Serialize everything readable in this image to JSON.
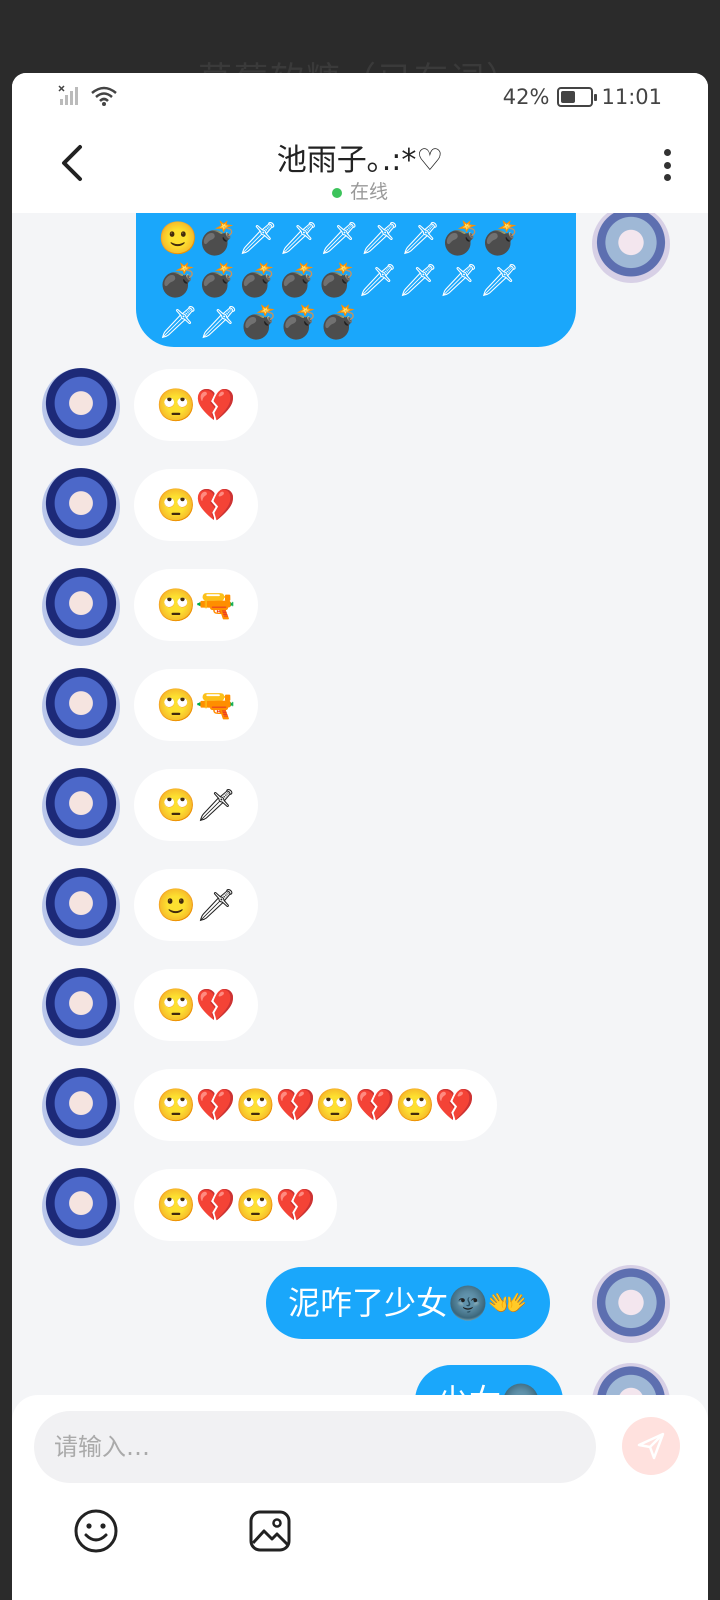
{
  "background_title": "草莓软糖（已有词）",
  "status": {
    "battery": "42%",
    "time": "11:01"
  },
  "header": {
    "title": "池雨子｡.:*♡",
    "status": "在线"
  },
  "messages": [
    {
      "from": "me",
      "text": "🙂💣🗡🗡🗡🗡🗡💣💣💣💣💣💣💣🗡🗡🗡🗡🗡🗡💣💣💣"
    },
    {
      "from": "her",
      "text": "🙄💔"
    },
    {
      "from": "her",
      "text": "🙄💔"
    },
    {
      "from": "her",
      "text": "🙄🔫"
    },
    {
      "from": "her",
      "text": "🙄🔫"
    },
    {
      "from": "her",
      "text": "🙄🗡"
    },
    {
      "from": "her",
      "text": "🙂🗡"
    },
    {
      "from": "her",
      "text": "🙄💔"
    },
    {
      "from": "her",
      "text": "🙄💔🙄💔🙄💔🙄💔"
    },
    {
      "from": "her",
      "text": "🙄💔🙄💔"
    },
    {
      "from": "me",
      "text": "泥咋了少女🌚👐"
    },
    {
      "from": "me",
      "text": "少女🌚"
    }
  ],
  "composer": {
    "placeholder": "请输入…"
  },
  "icons": {
    "back": "chevron-left-icon",
    "more": "more-vertical-icon",
    "send": "send-icon",
    "emoji": "emoji-icon",
    "image": "image-icon"
  },
  "colors": {
    "outgoing_bubble": "#1aa7fb",
    "incoming_bubble": "#ffffff",
    "online": "#3cc35b"
  }
}
